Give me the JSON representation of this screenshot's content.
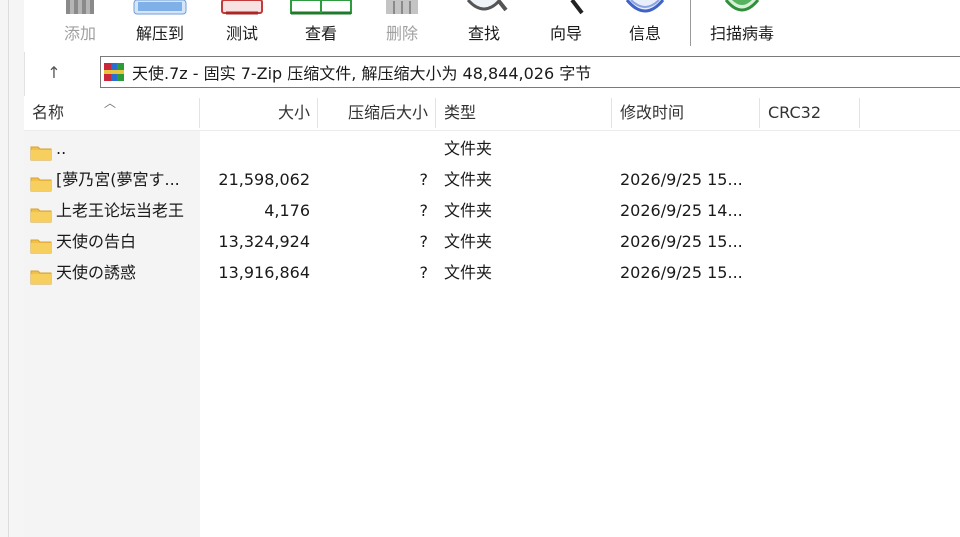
{
  "toolbar": {
    "buttons": [
      {
        "label": "添加",
        "icon": "add-icon",
        "enabled": false
      },
      {
        "label": "解压到",
        "icon": "extract-icon",
        "enabled": true
      },
      {
        "label": "测试",
        "icon": "test-icon",
        "enabled": true
      },
      {
        "label": "查看",
        "icon": "view-icon",
        "enabled": true
      },
      {
        "label": "删除",
        "icon": "delete-icon",
        "enabled": false
      },
      {
        "label": "查找",
        "icon": "find-icon",
        "enabled": true
      },
      {
        "label": "向导",
        "icon": "wizard-icon",
        "enabled": true
      },
      {
        "label": "信息",
        "icon": "info-icon",
        "enabled": true
      },
      {
        "label": "扫描病毒",
        "icon": "scan-virus-icon",
        "enabled": true
      }
    ]
  },
  "addressbar": {
    "up_glyph": "↑",
    "path": "天使.7z - 固实 7-Zip 压缩文件, 解压缩大小为 48,844,026 字节"
  },
  "columns": {
    "name": "名称",
    "size": "大小",
    "packed": "压缩后大小",
    "type": "类型",
    "modified": "修改时间",
    "crc": "CRC32"
  },
  "files": [
    {
      "name": "..",
      "size": "",
      "packed": "",
      "type": "文件夹",
      "modified": ""
    },
    {
      "name": "[夢乃宮(夢宮す...",
      "size": "21,598,062",
      "packed": "?",
      "type": "文件夹",
      "modified": "2026/9/25 15..."
    },
    {
      "name": "上老王论坛当老王",
      "size": "4,176",
      "packed": "?",
      "type": "文件夹",
      "modified": "2026/9/25 14..."
    },
    {
      "name": "天使の告白",
      "size": "13,324,924",
      "packed": "?",
      "type": "文件夹",
      "modified": "2026/9/25 15..."
    },
    {
      "name": "天使の誘惑",
      "size": "13,916,864",
      "packed": "?",
      "type": "文件夹",
      "modified": "2026/9/25 15..."
    }
  ],
  "colors": {
    "folder": "#f0c04a",
    "folder_dark": "#d9a22e",
    "disabled_text": "#a0a0a0"
  }
}
